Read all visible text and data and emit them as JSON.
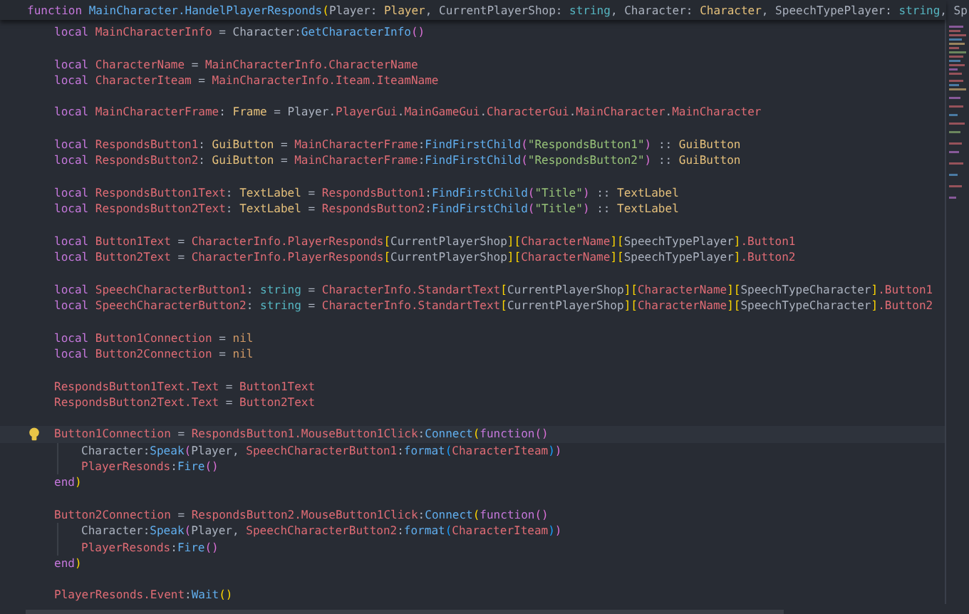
{
  "header": {
    "tokens": [
      {
        "kind": "kw",
        "text": "function"
      },
      {
        "kind": "fn",
        "text": " MainCharacter.HandelPlayerResponds"
      },
      {
        "kind": "b1",
        "text": "("
      },
      {
        "kind": "txt",
        "text": "Player: "
      },
      {
        "kind": "type",
        "text": "Player"
      },
      {
        "kind": "txt",
        "text": ", CurrentPlayerShop: "
      },
      {
        "kind": "prim",
        "text": "string"
      },
      {
        "kind": "txt",
        "text": ", Character: "
      },
      {
        "kind": "type",
        "text": "Character"
      },
      {
        "kind": "txt",
        "text": ", SpeechTypePlayer: "
      },
      {
        "kind": "prim",
        "text": "string"
      },
      {
        "kind": "txt",
        "text": ", Sp"
      }
    ]
  },
  "blocks": [
    [
      {
        "current": false,
        "tokens": [
          {
            "kind": "kw",
            "text": "local "
          },
          {
            "kind": "var",
            "text": "MainCharacterInfo"
          },
          {
            "kind": "txt",
            "text": " = Character:"
          },
          {
            "kind": "fn",
            "text": "GetCharacterInfo"
          },
          {
            "kind": "b2",
            "text": "()"
          }
        ]
      }
    ],
    [
      {
        "current": false,
        "tokens": [
          {
            "kind": "kw",
            "text": "local "
          },
          {
            "kind": "var",
            "text": "CharacterName"
          },
          {
            "kind": "txt",
            "text": " = "
          },
          {
            "kind": "var",
            "text": "MainCharacterInfo.CharacterName"
          }
        ]
      },
      {
        "current": false,
        "tokens": [
          {
            "kind": "kw",
            "text": "local "
          },
          {
            "kind": "var",
            "text": "CharacterIteam"
          },
          {
            "kind": "txt",
            "text": " = "
          },
          {
            "kind": "var",
            "text": "MainCharacterInfo.Iteam.IteamName"
          }
        ]
      }
    ],
    [
      {
        "current": false,
        "tokens": [
          {
            "kind": "kw",
            "text": "local "
          },
          {
            "kind": "var",
            "text": "MainCharacterFrame"
          },
          {
            "kind": "txt",
            "text": ": "
          },
          {
            "kind": "type",
            "text": "Frame"
          },
          {
            "kind": "txt",
            "text": " = Player."
          },
          {
            "kind": "var",
            "text": "PlayerGui"
          },
          {
            "kind": "txt",
            "text": "."
          },
          {
            "kind": "var",
            "text": "MainGameGui"
          },
          {
            "kind": "txt",
            "text": "."
          },
          {
            "kind": "var",
            "text": "CharacterGui"
          },
          {
            "kind": "txt",
            "text": "."
          },
          {
            "kind": "var",
            "text": "MainCharacter"
          },
          {
            "kind": "txt",
            "text": "."
          },
          {
            "kind": "var",
            "text": "MainCharacter"
          }
        ]
      }
    ],
    [
      {
        "current": false,
        "tokens": [
          {
            "kind": "kw",
            "text": "local "
          },
          {
            "kind": "var",
            "text": "RespondsButton1"
          },
          {
            "kind": "txt",
            "text": ": "
          },
          {
            "kind": "type",
            "text": "GuiButton"
          },
          {
            "kind": "txt",
            "text": " = "
          },
          {
            "kind": "var",
            "text": "MainCharacterFrame"
          },
          {
            "kind": "txt",
            "text": ":"
          },
          {
            "kind": "fn",
            "text": "FindFirstChild"
          },
          {
            "kind": "b2",
            "text": "("
          },
          {
            "kind": "str",
            "text": "\"RespondsButton1\""
          },
          {
            "kind": "b2",
            "text": ")"
          },
          {
            "kind": "txt",
            "text": " :: "
          },
          {
            "kind": "type",
            "text": "GuiButton"
          }
        ]
      },
      {
        "current": false,
        "tokens": [
          {
            "kind": "kw",
            "text": "local "
          },
          {
            "kind": "var",
            "text": "RespondsButton2"
          },
          {
            "kind": "txt",
            "text": ": "
          },
          {
            "kind": "type",
            "text": "GuiButton"
          },
          {
            "kind": "txt",
            "text": " = "
          },
          {
            "kind": "var",
            "text": "MainCharacterFrame"
          },
          {
            "kind": "txt",
            "text": ":"
          },
          {
            "kind": "fn",
            "text": "FindFirstChild"
          },
          {
            "kind": "b2",
            "text": "("
          },
          {
            "kind": "str",
            "text": "\"RespondsButton2\""
          },
          {
            "kind": "b2",
            "text": ")"
          },
          {
            "kind": "txt",
            "text": " :: "
          },
          {
            "kind": "type",
            "text": "GuiButton"
          }
        ]
      }
    ],
    [
      {
        "current": false,
        "tokens": [
          {
            "kind": "kw",
            "text": "local "
          },
          {
            "kind": "var",
            "text": "RespondsButton1Text"
          },
          {
            "kind": "txt",
            "text": ": "
          },
          {
            "kind": "type",
            "text": "TextLabel"
          },
          {
            "kind": "txt",
            "text": " = "
          },
          {
            "kind": "var",
            "text": "RespondsButton1"
          },
          {
            "kind": "txt",
            "text": ":"
          },
          {
            "kind": "fn",
            "text": "FindFirstChild"
          },
          {
            "kind": "b2",
            "text": "("
          },
          {
            "kind": "str",
            "text": "\"Title\""
          },
          {
            "kind": "b2",
            "text": ")"
          },
          {
            "kind": "txt",
            "text": " :: "
          },
          {
            "kind": "type",
            "text": "TextLabel"
          }
        ]
      },
      {
        "current": false,
        "tokens": [
          {
            "kind": "kw",
            "text": "local "
          },
          {
            "kind": "var",
            "text": "RespondsButton2Text"
          },
          {
            "kind": "txt",
            "text": ": "
          },
          {
            "kind": "type",
            "text": "TextLabel"
          },
          {
            "kind": "txt",
            "text": " = "
          },
          {
            "kind": "var",
            "text": "RespondsButton2"
          },
          {
            "kind": "txt",
            "text": ":"
          },
          {
            "kind": "fn",
            "text": "FindFirstChild"
          },
          {
            "kind": "b2",
            "text": "("
          },
          {
            "kind": "str",
            "text": "\"Title\""
          },
          {
            "kind": "b2",
            "text": ")"
          },
          {
            "kind": "txt",
            "text": " :: "
          },
          {
            "kind": "type",
            "text": "TextLabel"
          }
        ]
      }
    ],
    [
      {
        "current": false,
        "tokens": [
          {
            "kind": "kw",
            "text": "local "
          },
          {
            "kind": "var",
            "text": "Button1Text"
          },
          {
            "kind": "txt",
            "text": " = "
          },
          {
            "kind": "var",
            "text": "CharacterInfo.PlayerResponds"
          },
          {
            "kind": "b1",
            "text": "["
          },
          {
            "kind": "txt",
            "text": "CurrentPlayerShop"
          },
          {
            "kind": "b1",
            "text": "]["
          },
          {
            "kind": "var",
            "text": "CharacterName"
          },
          {
            "kind": "b1",
            "text": "]["
          },
          {
            "kind": "txt",
            "text": "SpeechTypePlayer"
          },
          {
            "kind": "b1",
            "text": "]"
          },
          {
            "kind": "var",
            "text": ".Button1"
          }
        ]
      },
      {
        "current": false,
        "tokens": [
          {
            "kind": "kw",
            "text": "local "
          },
          {
            "kind": "var",
            "text": "Button2Text"
          },
          {
            "kind": "txt",
            "text": " = "
          },
          {
            "kind": "var",
            "text": "CharacterInfo.PlayerResponds"
          },
          {
            "kind": "b1",
            "text": "["
          },
          {
            "kind": "txt",
            "text": "CurrentPlayerShop"
          },
          {
            "kind": "b1",
            "text": "]["
          },
          {
            "kind": "var",
            "text": "CharacterName"
          },
          {
            "kind": "b1",
            "text": "]["
          },
          {
            "kind": "txt",
            "text": "SpeechTypePlayer"
          },
          {
            "kind": "b1",
            "text": "]"
          },
          {
            "kind": "var",
            "text": ".Button2"
          }
        ]
      }
    ],
    [
      {
        "current": false,
        "tokens": [
          {
            "kind": "kw",
            "text": "local "
          },
          {
            "kind": "var",
            "text": "SpeechCharacterButton1"
          },
          {
            "kind": "txt",
            "text": ": "
          },
          {
            "kind": "prim",
            "text": "string"
          },
          {
            "kind": "txt",
            "text": " = "
          },
          {
            "kind": "var",
            "text": "CharacterInfo.StandartText"
          },
          {
            "kind": "b1",
            "text": "["
          },
          {
            "kind": "txt",
            "text": "CurrentPlayerShop"
          },
          {
            "kind": "b1",
            "text": "]["
          },
          {
            "kind": "var",
            "text": "CharacterName"
          },
          {
            "kind": "b1",
            "text": "]["
          },
          {
            "kind": "txt",
            "text": "SpeechTypeCharacter"
          },
          {
            "kind": "b1",
            "text": "]"
          },
          {
            "kind": "var",
            "text": ".Button1"
          }
        ]
      },
      {
        "current": false,
        "tokens": [
          {
            "kind": "kw",
            "text": "local "
          },
          {
            "kind": "var",
            "text": "SpeechCharacterButton2"
          },
          {
            "kind": "txt",
            "text": ": "
          },
          {
            "kind": "prim",
            "text": "string"
          },
          {
            "kind": "txt",
            "text": " = "
          },
          {
            "kind": "var",
            "text": "CharacterInfo.StandartText"
          },
          {
            "kind": "b1",
            "text": "["
          },
          {
            "kind": "txt",
            "text": "CurrentPlayerShop"
          },
          {
            "kind": "b1",
            "text": "]["
          },
          {
            "kind": "var",
            "text": "CharacterName"
          },
          {
            "kind": "b1",
            "text": "]["
          },
          {
            "kind": "txt",
            "text": "SpeechTypeCharacter"
          },
          {
            "kind": "b1",
            "text": "]"
          },
          {
            "kind": "var",
            "text": ".Button2"
          }
        ]
      }
    ],
    [
      {
        "current": false,
        "tokens": [
          {
            "kind": "kw",
            "text": "local "
          },
          {
            "kind": "var",
            "text": "Button1Connection"
          },
          {
            "kind": "txt",
            "text": " = "
          },
          {
            "kind": "nil",
            "text": "nil"
          }
        ]
      },
      {
        "current": false,
        "tokens": [
          {
            "kind": "kw",
            "text": "local "
          },
          {
            "kind": "var",
            "text": "Button2Connection"
          },
          {
            "kind": "txt",
            "text": " = "
          },
          {
            "kind": "nil",
            "text": "nil"
          }
        ]
      }
    ],
    [
      {
        "current": false,
        "tokens": [
          {
            "kind": "var",
            "text": "RespondsButton1Text.Text"
          },
          {
            "kind": "txt",
            "text": " = "
          },
          {
            "kind": "var",
            "text": "Button1Text"
          }
        ]
      },
      {
        "current": false,
        "tokens": [
          {
            "kind": "var",
            "text": "RespondsButton2Text.Text"
          },
          {
            "kind": "txt",
            "text": " = "
          },
          {
            "kind": "var",
            "text": "Button2Text"
          }
        ]
      }
    ],
    [
      {
        "current": true,
        "tokens": [
          {
            "kind": "var",
            "text": "Button1Connection"
          },
          {
            "kind": "txt",
            "text": " = "
          },
          {
            "kind": "var",
            "text": "RespondsButton1.MouseButton1Click"
          },
          {
            "kind": "txt",
            "text": ":"
          },
          {
            "kind": "fn",
            "text": "Connect"
          },
          {
            "kind": "b1",
            "text": "("
          },
          {
            "kind": "kw",
            "text": "function"
          },
          {
            "kind": "b2",
            "text": "()"
          }
        ],
        "children": [
          {
            "current": false,
            "tokens": [
              {
                "kind": "txt",
                "text": "Character:"
              },
              {
                "kind": "fn",
                "text": "Speak"
              },
              {
                "kind": "b2",
                "text": "("
              },
              {
                "kind": "txt",
                "text": "Player, "
              },
              {
                "kind": "var",
                "text": "SpeechCharacterButton1"
              },
              {
                "kind": "txt",
                "text": ":"
              },
              {
                "kind": "fn",
                "text": "format"
              },
              {
                "kind": "b3",
                "text": "("
              },
              {
                "kind": "var",
                "text": "CharacterIteam"
              },
              {
                "kind": "b3",
                "text": ")"
              },
              {
                "kind": "b2",
                "text": ")"
              }
            ]
          },
          {
            "current": false,
            "tokens": [
              {
                "kind": "var",
                "text": "PlayerResonds"
              },
              {
                "kind": "txt",
                "text": ":"
              },
              {
                "kind": "fn",
                "text": "Fire"
              },
              {
                "kind": "b2",
                "text": "()"
              }
            ]
          }
        ]
      },
      {
        "current": false,
        "tokens": [
          {
            "kind": "kw",
            "text": "end"
          },
          {
            "kind": "b1",
            "text": ")"
          }
        ]
      }
    ],
    [
      {
        "current": false,
        "tokens": [
          {
            "kind": "var",
            "text": "Button2Connection"
          },
          {
            "kind": "txt",
            "text": " = "
          },
          {
            "kind": "var",
            "text": "RespondsButton2.MouseButton1Click"
          },
          {
            "kind": "txt",
            "text": ":"
          },
          {
            "kind": "fn",
            "text": "Connect"
          },
          {
            "kind": "b1",
            "text": "("
          },
          {
            "kind": "kw",
            "text": "function"
          },
          {
            "kind": "b2",
            "text": "()"
          }
        ],
        "children": [
          {
            "current": false,
            "tokens": [
              {
                "kind": "txt",
                "text": "Character:"
              },
              {
                "kind": "fn",
                "text": "Speak"
              },
              {
                "kind": "b2",
                "text": "("
              },
              {
                "kind": "txt",
                "text": "Player, "
              },
              {
                "kind": "var",
                "text": "SpeechCharacterButton2"
              },
              {
                "kind": "txt",
                "text": ":"
              },
              {
                "kind": "fn",
                "text": "format"
              },
              {
                "kind": "b3",
                "text": "("
              },
              {
                "kind": "var",
                "text": "CharacterIteam"
              },
              {
                "kind": "b3",
                "text": ")"
              },
              {
                "kind": "b2",
                "text": ")"
              }
            ]
          },
          {
            "current": false,
            "tokens": [
              {
                "kind": "var",
                "text": "PlayerResonds"
              },
              {
                "kind": "txt",
                "text": ":"
              },
              {
                "kind": "fn",
                "text": "Fire"
              },
              {
                "kind": "b2",
                "text": "()"
              }
            ]
          }
        ]
      },
      {
        "current": false,
        "tokens": [
          {
            "kind": "kw",
            "text": "end"
          },
          {
            "kind": "b1",
            "text": ")"
          }
        ]
      }
    ],
    [
      {
        "current": false,
        "tokens": [
          {
            "kind": "var",
            "text": "PlayerResonds.Event"
          },
          {
            "kind": "txt",
            "text": ":"
          },
          {
            "kind": "fn",
            "text": "Wait"
          },
          {
            "kind": "b1",
            "text": "()"
          }
        ]
      }
    ]
  ]
}
